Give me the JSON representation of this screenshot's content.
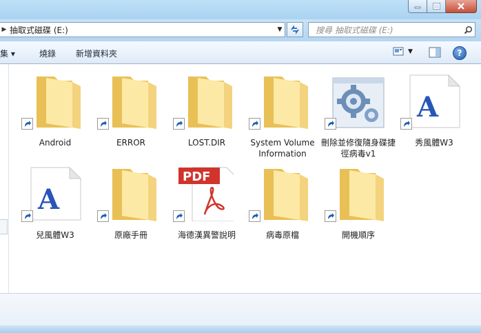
{
  "address": {
    "path": "抽取式磁碟 (E:)"
  },
  "search": {
    "placeholder": "搜尋 抽取式磁碟 (E:)"
  },
  "toolbar": {
    "organize_label": "集 ▾",
    "burn_label": "燒錄",
    "new_folder_label": "新增資料夾"
  },
  "files": [
    {
      "name": "Android",
      "type": "folder",
      "shortcut": true
    },
    {
      "name": "ERROR",
      "type": "folder",
      "shortcut": true
    },
    {
      "name": "LOST.DIR",
      "type": "folder",
      "shortcut": true
    },
    {
      "name": "System Volume Information",
      "type": "folder",
      "shortcut": true
    },
    {
      "name": "刪除並修復隨身碟捷徑病毒v1",
      "type": "app",
      "shortcut": true
    },
    {
      "name": "秀風體W3",
      "type": "font",
      "shortcut": true
    },
    {
      "name": "兒風體W3",
      "type": "font",
      "shortcut": true
    },
    {
      "name": "原廠手冊",
      "type": "folder",
      "shortcut": true
    },
    {
      "name": "海德漢異警說明",
      "type": "pdf",
      "shortcut": true,
      "pdf_badge": "PDF"
    },
    {
      "name": "病毒原檔",
      "type": "folder",
      "shortcut": true
    },
    {
      "name": "開機順序",
      "type": "folder",
      "shortcut": true
    }
  ],
  "colors": {
    "folder_light": "#fde9a6",
    "folder_dark": "#e9c055",
    "pdf_red": "#d0342b",
    "font_blue": "#2a55b8",
    "shortcut_arrow": "#1f5fb4"
  },
  "icons": {
    "help": "help-icon",
    "refresh": "refresh-icon",
    "search": "search-icon"
  }
}
